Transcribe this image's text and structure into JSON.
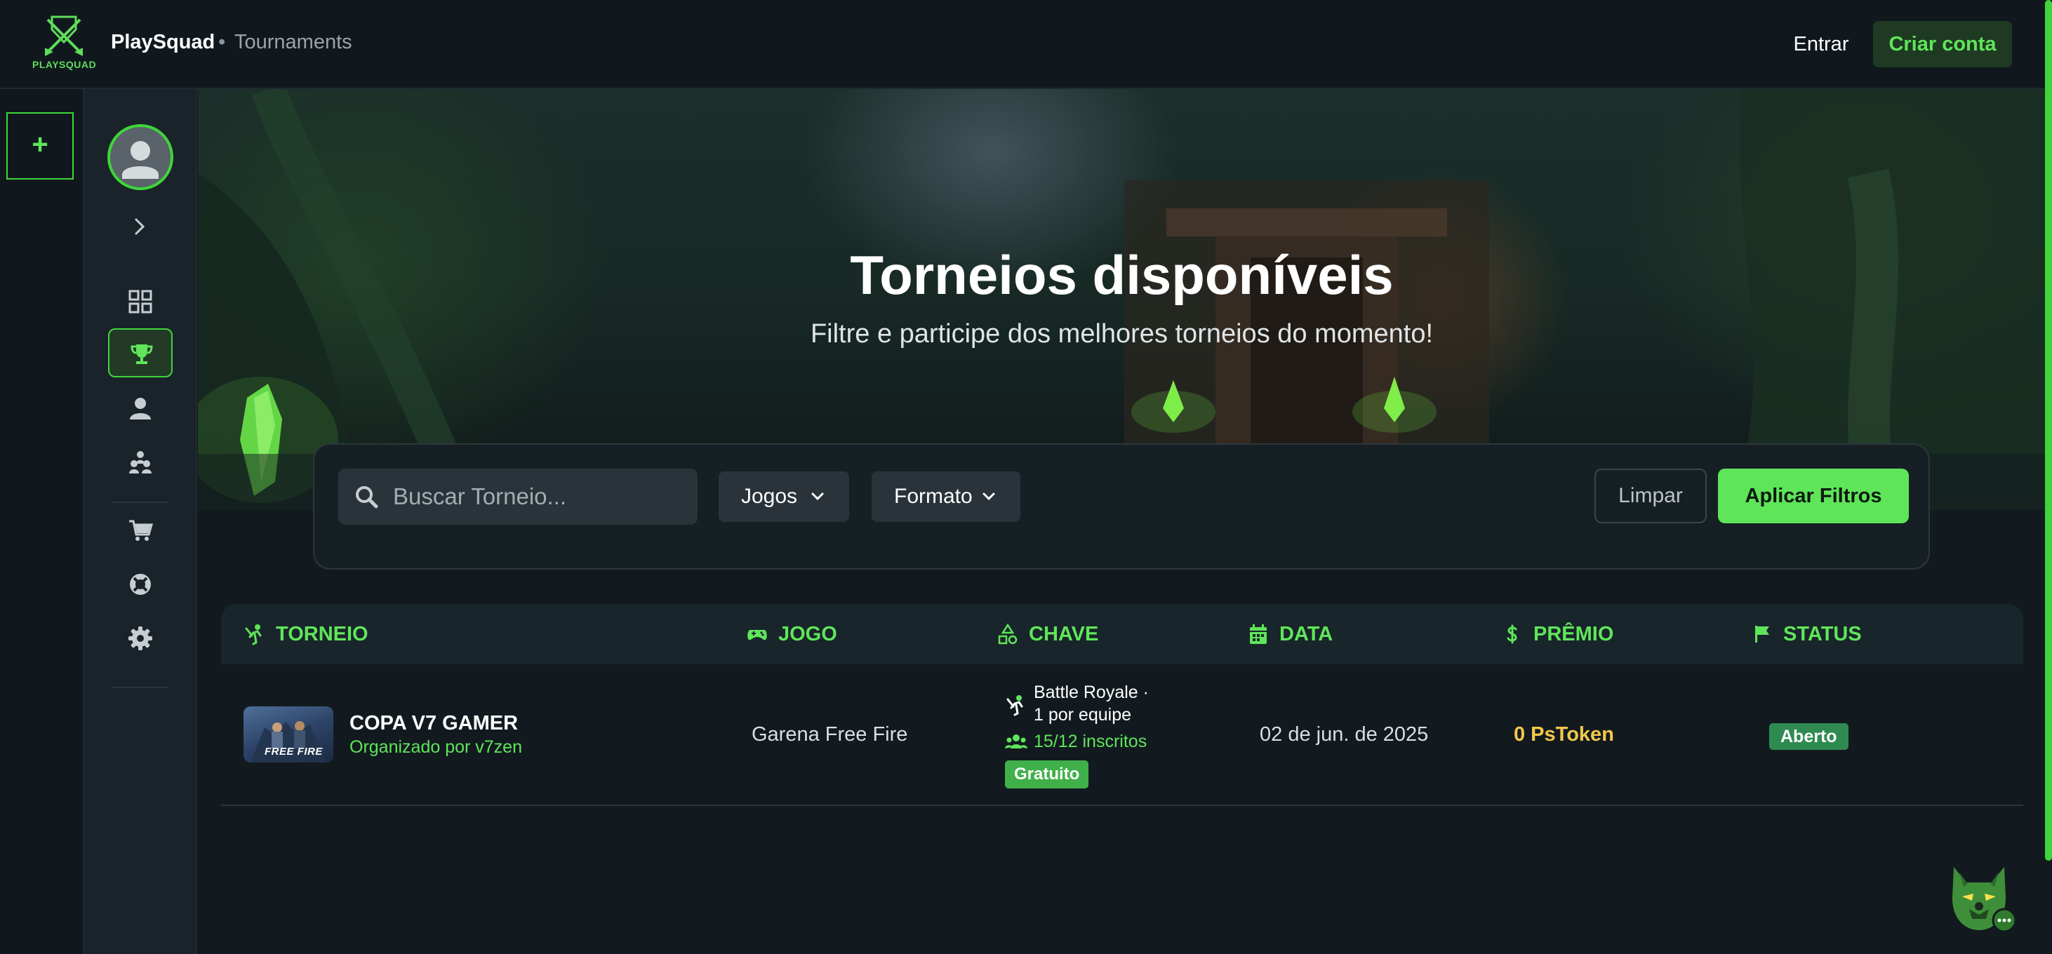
{
  "header": {
    "logo_text": "PLAYSQUAD",
    "brand": "PlaySquad",
    "separator": "•",
    "section": "Tournaments",
    "login_label": "Entrar",
    "signup_label": "Criar conta"
  },
  "rail": {
    "add_label": "+"
  },
  "sidebar": {
    "items": [
      "dashboard",
      "tournaments",
      "profile",
      "teams",
      "shop",
      "support",
      "settings"
    ],
    "active": "tournaments"
  },
  "hero": {
    "title": "Torneios disponíveis",
    "subtitle": "Filtre e participe dos melhores torneios do momento!"
  },
  "filters": {
    "search_placeholder": "Buscar Torneio...",
    "games_label": "Jogos",
    "format_label": "Formato",
    "clear_label": "Limpar",
    "apply_label": "Aplicar Filtros"
  },
  "table": {
    "headers": [
      "TORNEIO",
      "JOGO",
      "CHAVE",
      "DATA",
      "PRÊMIO",
      "STATUS"
    ],
    "rows": [
      {
        "thumb_text": "FREE FIRE",
        "name": "COPA V7 GAMER",
        "organizer": "Organizado por v7zen",
        "game": "Garena Free Fire",
        "format": "Battle Royale · 1 por equipe",
        "registered": "15/12 inscritos",
        "entry": "Gratuito",
        "date": "02 de jun. de 2025",
        "prize": "0 PsToken",
        "status": "Aberto"
      }
    ]
  },
  "colors": {
    "accent": "#5ee55a",
    "background": "#121a1f",
    "prize": "#f2c84b",
    "status_open": "#2f8a52"
  }
}
